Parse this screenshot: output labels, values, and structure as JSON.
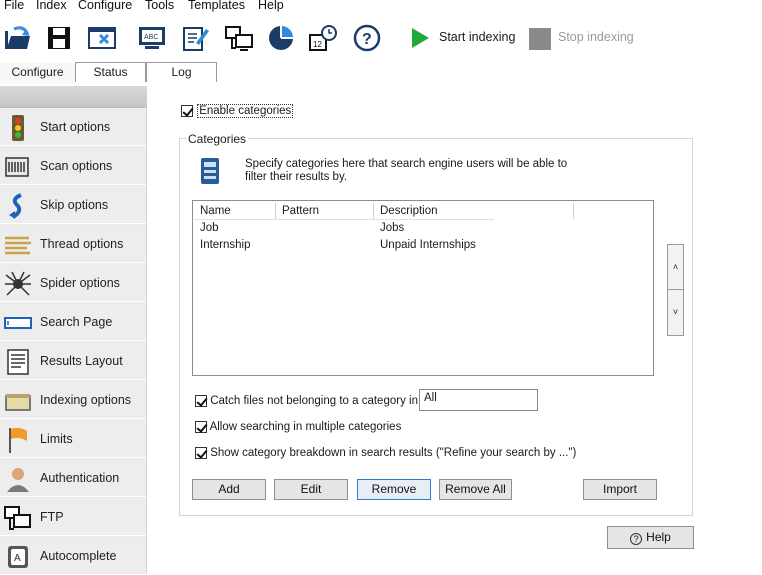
{
  "menu": [
    "File",
    "Index",
    "Configure",
    "Tools",
    "Templates",
    "Help"
  ],
  "toolbar": {
    "icons": [
      "open-index-icon",
      "save-icon",
      "close-file-icon",
      "template-icon",
      "edit-icon",
      "network-icon",
      "pie-chart-icon",
      "scheduler-icon",
      "help-circle-icon"
    ],
    "start_label": "Start indexing",
    "stop_label": "Stop indexing"
  },
  "tabs": [
    "Configure",
    "Status",
    "Log"
  ],
  "sidebar": {
    "items": [
      {
        "label": "Start options",
        "icon": "traffic-light-icon"
      },
      {
        "label": "Scan options",
        "icon": "scanner-icon"
      },
      {
        "label": "Skip options",
        "icon": "skip-arrow-icon"
      },
      {
        "label": "Thread options",
        "icon": "threads-icon"
      },
      {
        "label": "Spider options",
        "icon": "spider-icon"
      },
      {
        "label": "Search Page",
        "icon": "search-box-icon"
      },
      {
        "label": "Results Layout",
        "icon": "layout-icon"
      },
      {
        "label": "Indexing options",
        "icon": "drive-icon"
      },
      {
        "label": "Limits",
        "icon": "flag-icon"
      },
      {
        "label": "Authentication",
        "icon": "user-icon"
      },
      {
        "label": "FTP",
        "icon": "ftp-icon"
      },
      {
        "label": "Autocomplete",
        "icon": "autocomplete-icon"
      }
    ]
  },
  "main": {
    "enable_categories_label": "Enable categories",
    "enable_categories_checked": true,
    "group_title": "Categories",
    "info_text": "Specify categories here that search engine users will be able to filter their results by.",
    "columns": [
      "Name",
      "Pattern",
      "Description"
    ],
    "rows": [
      {
        "name": "Job",
        "pattern": "",
        "description": "Jobs"
      },
      {
        "name": "Internship",
        "pattern": "",
        "description": "Unpaid Internships"
      }
    ],
    "move_up": "˄",
    "move_down": "˅",
    "catch_files_label": "Catch files not belonging to a category in:",
    "catch_files_checked": true,
    "catch_files_value": "All",
    "allow_multiple_label": "Allow searching in multiple categories",
    "allow_multiple_checked": true,
    "show_breakdown_label": "Show category breakdown in search results (\"Refine your search by ...\")",
    "show_breakdown_checked": true,
    "buttons": {
      "add": "Add",
      "edit": "Edit",
      "remove": "Remove",
      "remove_all": "Remove All",
      "import": "Import"
    },
    "help_label": "Help"
  }
}
